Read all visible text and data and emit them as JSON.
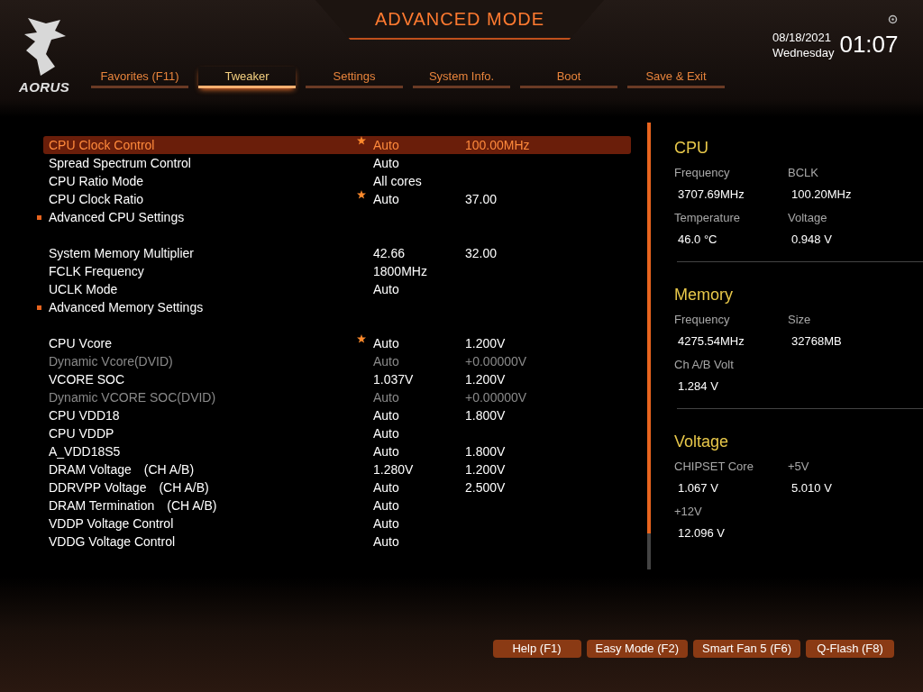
{
  "header": {
    "logo_text": "AORUS",
    "title": "ADVANCED MODE",
    "date": "08/18/2021",
    "day": "Wednesday",
    "time": "01:07"
  },
  "tabs": [
    {
      "label": "Favorites (F11)",
      "selected": false
    },
    {
      "label": "Tweaker",
      "selected": true
    },
    {
      "label": "Settings",
      "selected": false
    },
    {
      "label": "System Info.",
      "selected": false
    },
    {
      "label": "Boot",
      "selected": false
    },
    {
      "label": "Save & Exit",
      "selected": false
    }
  ],
  "settings": [
    {
      "kind": "setting",
      "label": "CPU Clock Control",
      "value": "Auto",
      "value_2": "100.00MHz",
      "starred": true,
      "disabled": false,
      "selected": true
    },
    {
      "kind": "setting",
      "label": "Spread Spectrum Control",
      "value": "Auto",
      "starred": false,
      "disabled": false,
      "selected": false
    },
    {
      "kind": "setting",
      "label": "CPU Ratio Mode",
      "value": "All cores",
      "starred": false,
      "disabled": false,
      "selected": false
    },
    {
      "kind": "setting",
      "label": "CPU Clock Ratio",
      "value": "Auto",
      "value_2": "37.00",
      "starred": true,
      "disabled": false,
      "selected": false
    },
    {
      "kind": "submenu",
      "label": "Advanced CPU Settings",
      "selected": false
    },
    {
      "kind": "spacer"
    },
    {
      "kind": "setting",
      "label": "System Memory Multiplier",
      "value": "42.66",
      "value_2": "32.00",
      "starred": false,
      "disabled": false,
      "selected": false
    },
    {
      "kind": "setting",
      "label": "FCLK Frequency",
      "value": "1800MHz",
      "starred": false,
      "disabled": false,
      "selected": false
    },
    {
      "kind": "setting",
      "label": "UCLK Mode",
      "value": "Auto",
      "starred": false,
      "disabled": false,
      "selected": false
    },
    {
      "kind": "submenu",
      "label": "Advanced Memory Settings",
      "selected": false
    },
    {
      "kind": "spacer"
    },
    {
      "kind": "setting",
      "label": "CPU Vcore",
      "value": "Auto",
      "value_2": "1.200V",
      "starred": true,
      "disabled": false,
      "selected": false
    },
    {
      "kind": "setting",
      "label": "Dynamic Vcore(DVID)",
      "value": "Auto",
      "value_2": "+0.00000V",
      "starred": false,
      "disabled": true,
      "selected": false
    },
    {
      "kind": "setting",
      "label": "VCORE SOC",
      "value": "1.037V",
      "value_2": "1.200V",
      "starred": false,
      "disabled": false,
      "selected": false
    },
    {
      "kind": "setting",
      "label": "Dynamic VCORE SOC(DVID)",
      "value": "Auto",
      "value_2": "+0.00000V",
      "starred": false,
      "disabled": true,
      "selected": false
    },
    {
      "kind": "setting",
      "label": "CPU VDD18",
      "value": "Auto",
      "value_2": "1.800V",
      "starred": false,
      "disabled": false,
      "selected": false
    },
    {
      "kind": "setting",
      "label": "CPU VDDP",
      "value": "Auto",
      "starred": false,
      "disabled": false,
      "selected": false
    },
    {
      "kind": "setting",
      "label": "A_VDD18S5",
      "value": "Auto",
      "value_2": "1.800V",
      "starred": false,
      "disabled": false,
      "selected": false
    },
    {
      "kind": "setting",
      "label": "DRAM Voltage",
      "channel": "(CH A/B)",
      "value": "1.280V",
      "value_2": "1.200V",
      "starred": false,
      "disabled": false,
      "selected": false
    },
    {
      "kind": "setting",
      "label": "DDRVPP Voltage",
      "channel": "(CH A/B)",
      "value": "Auto",
      "value_2": "2.500V",
      "starred": false,
      "disabled": false,
      "selected": false
    },
    {
      "kind": "setting",
      "label": "DRAM Termination",
      "channel": "(CH A/B)",
      "value": "Auto",
      "starred": false,
      "disabled": false,
      "selected": false
    },
    {
      "kind": "setting",
      "label": "VDDP Voltage Control",
      "value": "Auto",
      "starred": false,
      "disabled": false,
      "selected": false
    },
    {
      "kind": "setting",
      "label": "VDDG Voltage Control",
      "value": "Auto",
      "starred": false,
      "disabled": false,
      "selected": false
    }
  ],
  "monitor": [
    {
      "title": "CPU",
      "items": [
        {
          "label": "Frequency",
          "value": "3707.69MHz"
        },
        {
          "label": "BCLK",
          "value": "100.20MHz"
        },
        {
          "label": "Temperature",
          "value": "46.0 °C"
        },
        {
          "label": "Voltage",
          "value": "0.948 V"
        }
      ]
    },
    {
      "title": "Memory",
      "items": [
        {
          "label": "Frequency",
          "value": "4275.54MHz"
        },
        {
          "label": "Size",
          "value": "32768MB"
        },
        {
          "label": "Ch A/B Volt",
          "value": "1.284 V"
        }
      ]
    },
    {
      "title": "Voltage",
      "items": [
        {
          "label": "CHIPSET Core",
          "value": "1.067 V"
        },
        {
          "label": "+5V",
          "value": "5.010 V"
        },
        {
          "label": "+12V",
          "value": "12.096 V"
        }
      ]
    }
  ],
  "buttons": [
    "Help (F1)",
    "Easy Mode (F2)",
    "Smart Fan 5 (F6)",
    "Q-Flash (F8)"
  ]
}
